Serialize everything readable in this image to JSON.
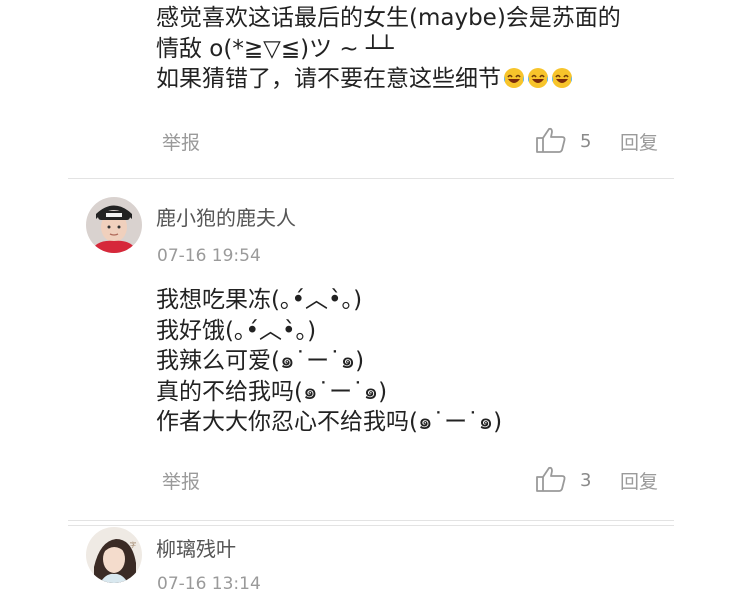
{
  "comments": [
    {
      "lines": [
        "感觉喜欢这话最后的女生(maybe)会是苏面的",
        "情敌 o(*≧▽≦)ツ ~ ┴┴",
        "如果猜错了，请不要在意这些细节"
      ],
      "trailing_emoji": "laughing-with-tears-emoji",
      "report_label": "举报",
      "likes": "5",
      "reply_label": "回复"
    },
    {
      "username": "鹿小狍的鹿夫人",
      "time": "07-16 19:54",
      "lines": [
        "我想吃果冻(｡•́︿•̀｡)",
        "我好饿(｡•́︿•̀｡)",
        "我辣么可爱(๑˙ー˙๑)",
        "真的不给我吗(๑˙ー˙๑)",
        "作者大大你忍心不给我吗(๑˙ー˙๑)"
      ],
      "report_label": "举报",
      "likes": "3",
      "reply_label": "回复"
    },
    {
      "username": "柳璃残叶",
      "time": "07-16 13:14"
    }
  ],
  "colors": {
    "text": "#222222",
    "meta": "#9a9a9a",
    "divider": "#e3e3e3"
  },
  "icons": {
    "like": "thumbs-up-outline-icon"
  }
}
